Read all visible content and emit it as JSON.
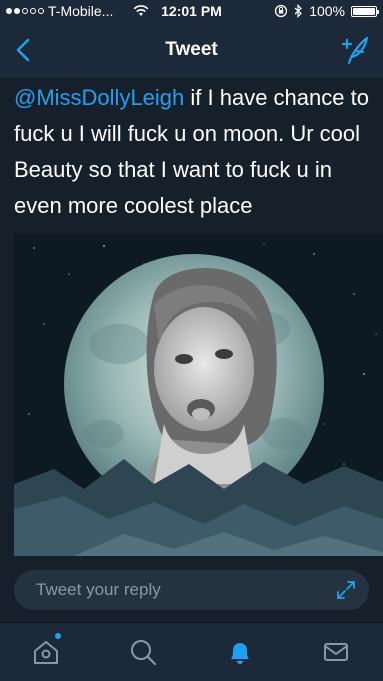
{
  "status_bar": {
    "carrier": "T-Mobile...",
    "time": "12:01 PM",
    "battery": "100%",
    "signal_bars_filled": 2,
    "signal_bars_total": 5
  },
  "nav": {
    "title": "Tweet",
    "back_icon": "chevron-left-icon",
    "compose_icon": "compose-tweet-icon"
  },
  "tweet": {
    "mention": "@MissDollyLeigh",
    "text": " if I have chance to fuck u I will fuck u on moon. Ur cool Beauty so that I want to fuck u in even more coolest place",
    "media": "photo-portrait-in-full-moon"
  },
  "reply": {
    "placeholder": "Tweet your reply",
    "expand_icon": "expand-arrows-icon"
  },
  "tabs": [
    {
      "name": "home",
      "icon": "home-icon",
      "has_dot": true
    },
    {
      "name": "search",
      "icon": "search-icon"
    },
    {
      "name": "notifications",
      "icon": "bell-icon",
      "active": true
    },
    {
      "name": "messages",
      "icon": "envelope-icon"
    }
  ],
  "colors": {
    "background": "#15202b",
    "bar": "#1c2938",
    "accent": "#1da1f2",
    "muted": "#8899a6"
  }
}
